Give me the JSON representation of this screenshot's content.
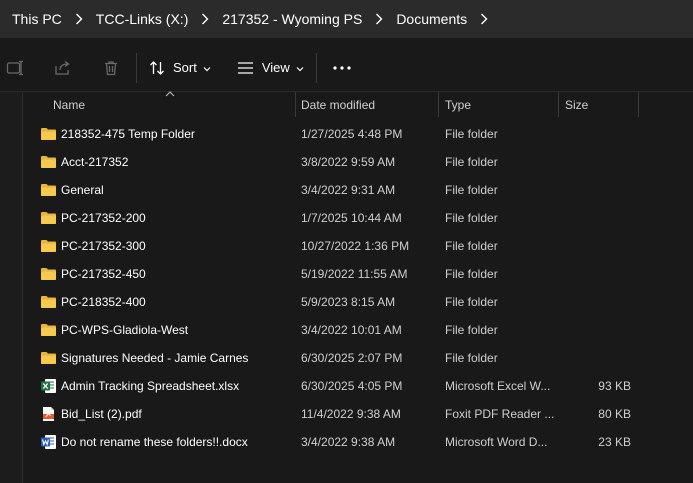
{
  "breadcrumb": [
    "This PC",
    "TCC-Links (X:)",
    "217352 - Wyoming PS",
    "Documents"
  ],
  "toolbar": {
    "icons": [
      "rename-icon",
      "share-icon",
      "delete-icon"
    ],
    "sort_label": "Sort",
    "view_label": "View",
    "more_icon": "more-icon"
  },
  "columns": {
    "name": "Name",
    "date": "Date modified",
    "type": "Type",
    "size": "Size",
    "sort_indicator": "^"
  },
  "items": [
    {
      "icon": "folder-icon",
      "name": "218352-475 Temp Folder",
      "date": "1/27/2025 4:48 PM",
      "type": "File folder",
      "size": ""
    },
    {
      "icon": "folder-icon",
      "name": "Acct-217352",
      "date": "3/8/2022 9:59 AM",
      "type": "File folder",
      "size": ""
    },
    {
      "icon": "folder-icon",
      "name": "General",
      "date": "3/4/2022 9:31 AM",
      "type": "File folder",
      "size": ""
    },
    {
      "icon": "folder-icon",
      "name": "PC-217352-200",
      "date": "1/7/2025 10:44 AM",
      "type": "File folder",
      "size": ""
    },
    {
      "icon": "folder-icon",
      "name": "PC-217352-300",
      "date": "10/27/2022 1:36 PM",
      "type": "File folder",
      "size": ""
    },
    {
      "icon": "folder-icon",
      "name": "PC-217352-450",
      "date": "5/19/2022 11:55 AM",
      "type": "File folder",
      "size": ""
    },
    {
      "icon": "folder-icon",
      "name": "PC-218352-400",
      "date": "5/9/2023 8:15 AM",
      "type": "File folder",
      "size": ""
    },
    {
      "icon": "folder-icon",
      "name": "PC-WPS-Gladiola-West",
      "date": "3/4/2022 10:01 AM",
      "type": "File folder",
      "size": ""
    },
    {
      "icon": "folder-icon",
      "name": "Signatures Needed - Jamie Carnes",
      "date": "6/30/2025 2:07 PM",
      "type": "File folder",
      "size": ""
    },
    {
      "icon": "excel-icon",
      "name": "Admin Tracking Spreadsheet.xlsx",
      "date": "6/30/2025 4:05 PM",
      "type": "Microsoft Excel W...",
      "size": "93 KB"
    },
    {
      "icon": "pdf-icon",
      "name": "Bid_List (2).pdf",
      "date": "11/4/2022 9:38 AM",
      "type": "Foxit PDF Reader ...",
      "size": "80 KB"
    },
    {
      "icon": "word-icon",
      "name": "Do not rename these folders!!.docx",
      "date": "3/4/2022 9:38 AM",
      "type": "Microsoft Word D...",
      "size": "23 KB"
    }
  ],
  "colors": {
    "folder": "#e8b43c",
    "excel": "#1f7244",
    "pdf": "#e25b2b",
    "word": "#2b5fb6",
    "background": "#191919",
    "address_bar": "#2b2b2b"
  }
}
